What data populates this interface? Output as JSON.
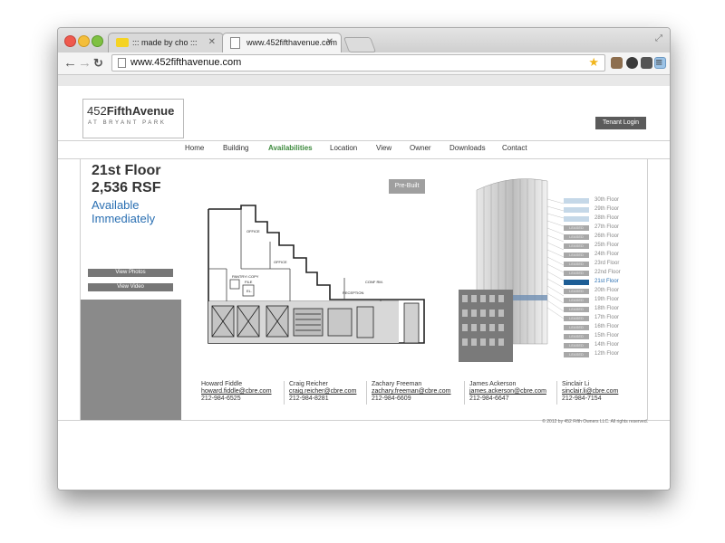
{
  "browser": {
    "tabs": [
      {
        "title": "::: made by cho :::",
        "active": false
      },
      {
        "title": "www.452fifthavenue.com",
        "active": true
      }
    ],
    "address": "www.452fifthavenue.com"
  },
  "site": {
    "logo": {
      "name_light": "452",
      "name_bold": "FifthAvenue",
      "tagline": "AT BRYANT PARK"
    },
    "tenant_login": "Tenant Login",
    "nav": [
      "Home",
      "Building",
      "Availabilities",
      "Location",
      "View",
      "Owner",
      "Downloads",
      "Contact"
    ],
    "nav_active": "Availabilities",
    "floor": {
      "title": "21st Floor",
      "rsf": "2,536 RSF",
      "availability_line1": "Available",
      "availability_line2": "Immediately"
    },
    "buttons": {
      "view_photos": "View Photos",
      "view_video": "View Video"
    },
    "prebuilt": "Pre-Built",
    "plan_labels": {
      "office1": "OFFICE",
      "office2": "OFFICE",
      "pantry": "PANTRY/ COPY",
      "file": "FILE",
      "el": "EL.",
      "conf": "CONF RM.",
      "reception": "RECEPTION"
    },
    "floors": [
      {
        "label": "30th Floor",
        "status": "open"
      },
      {
        "label": "29th Floor",
        "status": "open"
      },
      {
        "label": "28th Floor",
        "status": "open"
      },
      {
        "label": "27th Floor",
        "status": "leased"
      },
      {
        "label": "26th Floor",
        "status": "leased"
      },
      {
        "label": "25th Floor",
        "status": "leased"
      },
      {
        "label": "24th Floor",
        "status": "leased"
      },
      {
        "label": "23rd Floor",
        "status": "leased"
      },
      {
        "label": "22nd Floor",
        "status": "leased"
      },
      {
        "label": "21st Floor",
        "status": "current"
      },
      {
        "label": "20th Floor",
        "status": "leased"
      },
      {
        "label": "19th Floor",
        "status": "leased"
      },
      {
        "label": "18th Floor",
        "status": "leased"
      },
      {
        "label": "17th Floor",
        "status": "leased"
      },
      {
        "label": "16th Floor",
        "status": "leased"
      },
      {
        "label": "15th Floor",
        "status": "leased"
      },
      {
        "label": "14th Floor",
        "status": "leased"
      },
      {
        "label": "12th Floor",
        "status": "leased"
      }
    ],
    "leased_tag": "LEASED",
    "contacts": [
      {
        "name": "Howard Fiddle",
        "email": "howard.fiddle@cbre.com",
        "phone": "212-984-6525"
      },
      {
        "name": "Craig Reicher",
        "email": "craig.reicher@cbre.com",
        "phone": "212-984-8281"
      },
      {
        "name": "Zachary Freeman",
        "email": "zachary.freeman@cbre.com",
        "phone": "212-984-6609"
      },
      {
        "name": "James Ackerson",
        "email": "james.ackerson@cbre.com",
        "phone": "212-984-6647"
      },
      {
        "name": "Sinclair Li",
        "email": "sinclair.li@cbre.com",
        "phone": "212-984-7154"
      }
    ],
    "footer": "© 2012 by 452 Fifth Owners LLC. All rights reserved."
  },
  "colors": {
    "accent_blue": "#2a6fb2",
    "current_floor": "#1d5d95",
    "nav_active": "#3e8a3e",
    "panel_gray": "#8a8a8a"
  }
}
